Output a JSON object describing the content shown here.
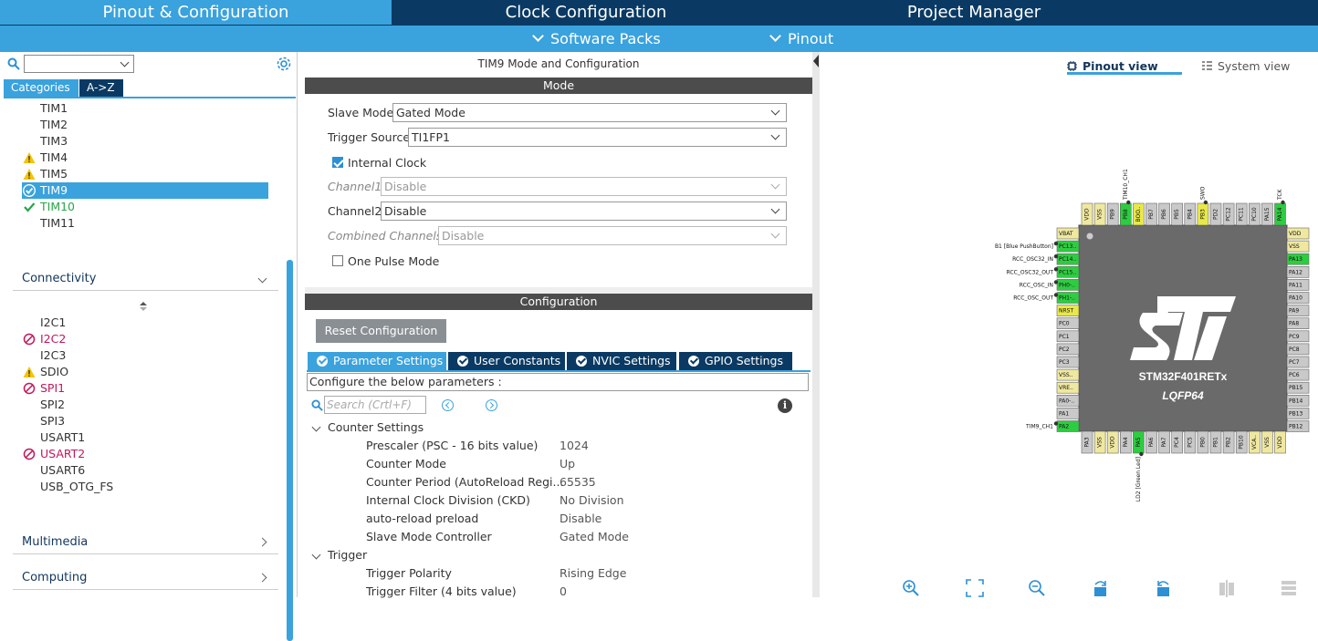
{
  "top_tabs": [
    {
      "label": "Pinout & Configuration",
      "active": true
    },
    {
      "label": "Clock Configuration",
      "active": false
    },
    {
      "label": "Project Manager",
      "active": false
    }
  ],
  "sub_menu": {
    "software_packs": "Software Packs",
    "pinout": "Pinout"
  },
  "left": {
    "search": {
      "value": "",
      "placeholder": ""
    },
    "tab_categories": "Categories",
    "tab_az": "A->Z",
    "timers": [
      {
        "label": "TIM1",
        "status": "none"
      },
      {
        "label": "TIM2",
        "status": "none"
      },
      {
        "label": "TIM3",
        "status": "none"
      },
      {
        "label": "TIM4",
        "status": "warning"
      },
      {
        "label": "TIM5",
        "status": "warning"
      },
      {
        "label": "TIM9",
        "status": "selected"
      },
      {
        "label": "TIM10",
        "status": "ok"
      },
      {
        "label": "TIM11",
        "status": "none"
      }
    ],
    "sections": {
      "connectivity": "Connectivity",
      "multimedia": "Multimedia",
      "computing": "Computing"
    },
    "connectivity": [
      {
        "label": "I2C1",
        "status": "none"
      },
      {
        "label": "I2C2",
        "status": "disabled"
      },
      {
        "label": "I2C3",
        "status": "none"
      },
      {
        "label": "SDIO",
        "status": "warning"
      },
      {
        "label": "SPI1",
        "status": "disabled"
      },
      {
        "label": "SPI2",
        "status": "none"
      },
      {
        "label": "SPI3",
        "status": "none"
      },
      {
        "label": "USART1",
        "status": "none"
      },
      {
        "label": "USART2",
        "status": "disabled"
      },
      {
        "label": "USART6",
        "status": "none"
      },
      {
        "label": "USB_OTG_FS",
        "status": "none"
      }
    ]
  },
  "mode": {
    "panel_title": "TIM9 Mode and Configuration",
    "header": "Mode",
    "slave_mode_label": "Slave Mode",
    "slave_mode_value": "Gated Mode",
    "trigger_source_label": "Trigger Source",
    "trigger_source_value": "TI1FP1",
    "internal_clock_label": "Internal Clock",
    "internal_clock_checked": true,
    "channel1_label": "Channel1",
    "channel1_value": "Disable",
    "channel2_label": "Channel2",
    "channel2_value": "Disable",
    "combined_label": "Combined Channels",
    "combined_value": "Disable",
    "one_pulse_label": "One Pulse Mode",
    "one_pulse_checked": false
  },
  "config": {
    "header": "Configuration",
    "reset_label": "Reset Configuration",
    "tabs": [
      {
        "label": "Parameter Settings",
        "active": true
      },
      {
        "label": "User Constants",
        "active": false
      },
      {
        "label": "NVIC Settings",
        "active": false
      },
      {
        "label": "GPIO Settings",
        "active": false
      }
    ],
    "configure_text": "Configure the below parameters :",
    "search_placeholder": "Search (Crtl+F)",
    "groups": [
      {
        "title": "Counter Settings",
        "params": [
          {
            "name": "Prescaler (PSC - 16 bits value)",
            "value": "1024"
          },
          {
            "name": "Counter Mode",
            "value": "Up"
          },
          {
            "name": "Counter Period (AutoReload Regi...",
            "value": "65535"
          },
          {
            "name": "Internal Clock Division (CKD)",
            "value": "No Division"
          },
          {
            "name": "auto-reload preload",
            "value": "Disable"
          },
          {
            "name": "Slave Mode Controller",
            "value": "Gated Mode"
          }
        ]
      },
      {
        "title": "Trigger",
        "params": [
          {
            "name": "Trigger Polarity",
            "value": "Rising Edge"
          },
          {
            "name": "Trigger Filter (4 bits value)",
            "value": "0"
          }
        ]
      }
    ]
  },
  "pinout": {
    "view_tabs": {
      "pinout_view": "Pinout view",
      "system_view": "System view"
    },
    "chip_name": "STM32F401RETx",
    "package": "LQFP64",
    "colors": {
      "green": "#2ecc40",
      "yellow": "#e8e84a",
      "khaki": "#efe8a0",
      "gray": "#c9c9c9",
      "chip": "#6a6a6a"
    },
    "top_pins": [
      {
        "label": "VDD",
        "c": "khaki"
      },
      {
        "label": "VSS",
        "c": "khaki"
      },
      {
        "label": "PB9",
        "c": "gray"
      },
      {
        "label": "PB8",
        "c": "green"
      },
      {
        "label": "BOO..",
        "c": "yellow"
      },
      {
        "label": "PB7",
        "c": "gray"
      },
      {
        "label": "PB6",
        "c": "gray"
      },
      {
        "label": "PB5",
        "c": "gray"
      },
      {
        "label": "PB4",
        "c": "gray"
      },
      {
        "label": "PB3",
        "c": "yellow"
      },
      {
        "label": "PD2",
        "c": "gray"
      },
      {
        "label": "PC12",
        "c": "gray"
      },
      {
        "label": "PC11",
        "c": "gray"
      },
      {
        "label": "PC10",
        "c": "gray"
      },
      {
        "label": "PA15",
        "c": "gray"
      },
      {
        "label": "PA14",
        "c": "green"
      }
    ],
    "top_signals": [
      {
        "index": 3,
        "label": "TIM10_CH1"
      },
      {
        "index": 9,
        "label": "SWO"
      },
      {
        "index": 15,
        "label": "TCK"
      }
    ],
    "left_pins": [
      {
        "label": "VBAT",
        "c": "khaki"
      },
      {
        "label": "PC13..",
        "c": "green"
      },
      {
        "label": "PC14..",
        "c": "green"
      },
      {
        "label": "PC15..",
        "c": "green"
      },
      {
        "label": "PH0-..",
        "c": "green"
      },
      {
        "label": "PH1-..",
        "c": "green"
      },
      {
        "label": "NRST",
        "c": "yellow"
      },
      {
        "label": "PC0",
        "c": "gray"
      },
      {
        "label": "PC1",
        "c": "gray"
      },
      {
        "label": "PC2",
        "c": "gray"
      },
      {
        "label": "PC3",
        "c": "gray"
      },
      {
        "label": "VSS..",
        "c": "khaki"
      },
      {
        "label": "VRE..",
        "c": "khaki"
      },
      {
        "label": "PA0-..",
        "c": "gray"
      },
      {
        "label": "PA1",
        "c": "gray"
      },
      {
        "label": "PA2",
        "c": "green"
      }
    ],
    "left_signals": [
      {
        "index": 1,
        "label": "B1 [Blue PushButton]"
      },
      {
        "index": 2,
        "label": "RCC_OSC32_IN"
      },
      {
        "index": 3,
        "label": "RCC_OSC32_OUT"
      },
      {
        "index": 4,
        "label": "RCC_OSC_IN"
      },
      {
        "index": 5,
        "label": "RCC_OSC_OUT"
      },
      {
        "index": 15,
        "label": "TIM9_CH1"
      }
    ],
    "right_pins": [
      {
        "label": "VDD",
        "c": "khaki"
      },
      {
        "label": "VSS",
        "c": "khaki"
      },
      {
        "label": "PA13",
        "c": "green"
      },
      {
        "label": "PA12",
        "c": "gray"
      },
      {
        "label": "PA11",
        "c": "gray"
      },
      {
        "label": "PA10",
        "c": "gray"
      },
      {
        "label": "PA9",
        "c": "gray"
      },
      {
        "label": "PA8",
        "c": "gray"
      },
      {
        "label": "PC9",
        "c": "gray"
      },
      {
        "label": "PC8",
        "c": "gray"
      },
      {
        "label": "PC7",
        "c": "gray"
      },
      {
        "label": "PC6",
        "c": "gray"
      },
      {
        "label": "PB15",
        "c": "gray"
      },
      {
        "label": "PB14",
        "c": "gray"
      },
      {
        "label": "PB13",
        "c": "gray"
      },
      {
        "label": "PB12",
        "c": "gray"
      }
    ],
    "bottom_pins": [
      {
        "label": "PA3",
        "c": "gray"
      },
      {
        "label": "VSS",
        "c": "khaki"
      },
      {
        "label": "VDD",
        "c": "khaki"
      },
      {
        "label": "PA4",
        "c": "gray"
      },
      {
        "label": "PA5",
        "c": "green"
      },
      {
        "label": "PA6",
        "c": "gray"
      },
      {
        "label": "PA7",
        "c": "gray"
      },
      {
        "label": "PC4",
        "c": "gray"
      },
      {
        "label": "PC5",
        "c": "gray"
      },
      {
        "label": "PB0",
        "c": "gray"
      },
      {
        "label": "PB1",
        "c": "gray"
      },
      {
        "label": "PB2",
        "c": "gray"
      },
      {
        "label": "PB10",
        "c": "gray"
      },
      {
        "label": "VCA..",
        "c": "khaki"
      },
      {
        "label": "VSS",
        "c": "khaki"
      },
      {
        "label": "VDD",
        "c": "khaki"
      }
    ],
    "bottom_signals": [
      {
        "index": 4,
        "label": "LD2 [Green Led]"
      }
    ],
    "toolbar": [
      "zoom-in-icon",
      "fit-icon",
      "zoom-out-icon",
      "rotate-right-icon",
      "rotate-left-icon",
      "flip-icon",
      "grid-icon"
    ]
  }
}
